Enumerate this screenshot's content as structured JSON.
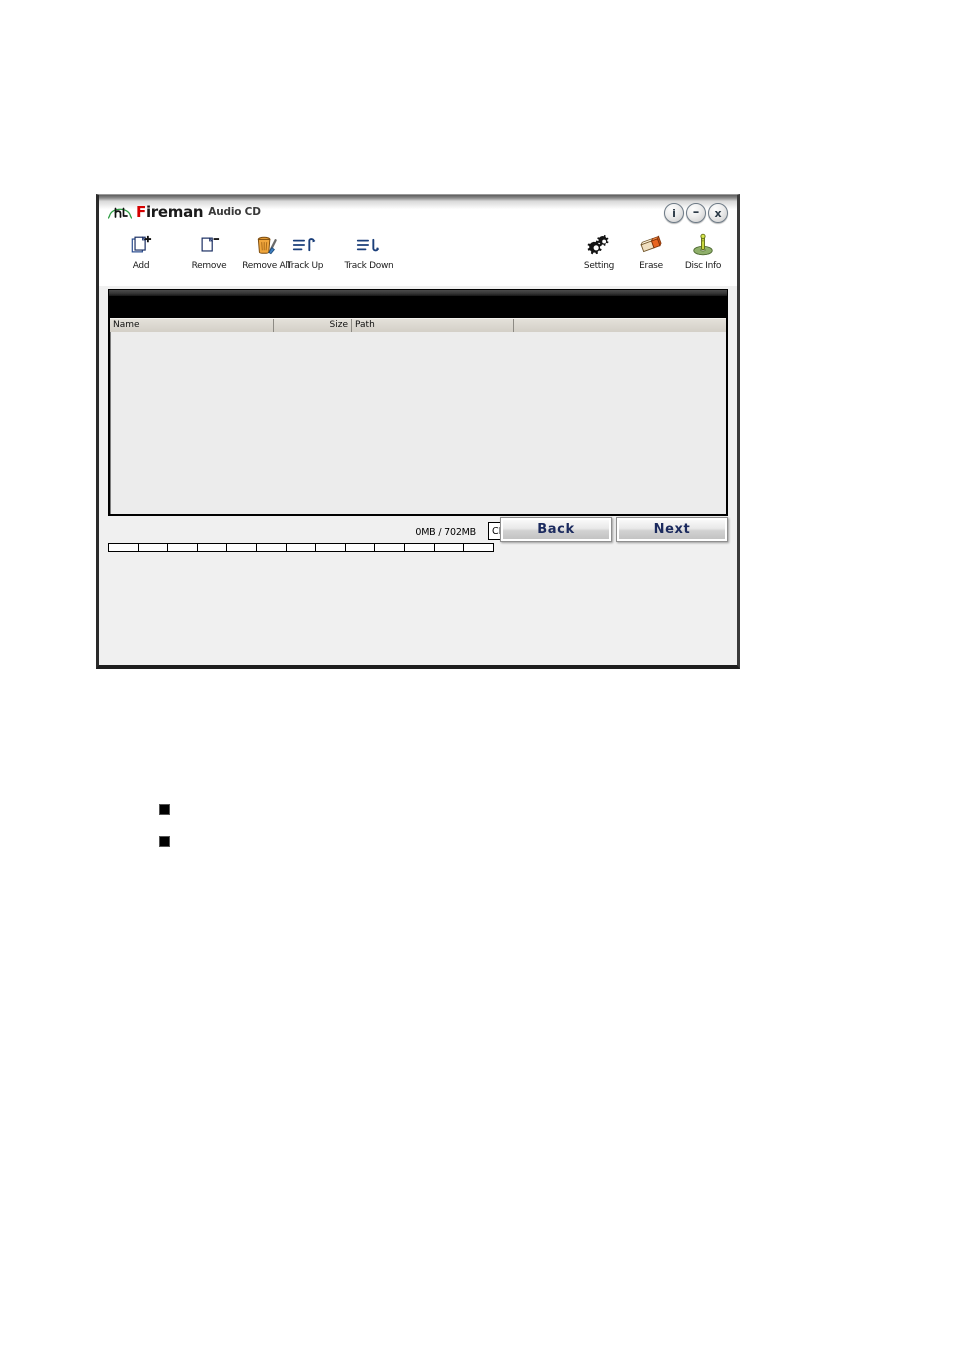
{
  "window": {
    "title_logo_mark": "fireman-logo-icon",
    "brand_first_letter": "F",
    "brand_rest": "ireman",
    "brand_sub": "Audio CD",
    "controls": [
      {
        "name": "info-button",
        "glyph": "i"
      },
      {
        "name": "minimize-button",
        "glyph": "–"
      },
      {
        "name": "close-button",
        "glyph": "x"
      }
    ]
  },
  "toolbar": {
    "left_tools": [
      {
        "label": "Add",
        "icon": "add-file-icon"
      },
      {
        "label": "Remove",
        "icon": "remove-file-icon"
      },
      {
        "label": "Remove All",
        "icon": "remove-all-trash-icon"
      }
    ],
    "mid_tools": [
      {
        "label": "Track Up",
        "icon": "track-up-icon"
      },
      {
        "label": "Track Down",
        "icon": "track-down-icon"
      }
    ],
    "right_tools": [
      {
        "label": "Setting",
        "icon": "gears-icon"
      },
      {
        "label": "Erase",
        "icon": "eraser-icon"
      },
      {
        "label": "Disc Info",
        "icon": "disc-info-icon"
      }
    ]
  },
  "list": {
    "columns": [
      {
        "key": "name",
        "label": "Name"
      },
      {
        "key": "size",
        "label": "Size"
      },
      {
        "key": "path",
        "label": "Path"
      }
    ],
    "rows": []
  },
  "status": {
    "capacity_text": "0MB / 702MB",
    "used_mb": 0,
    "total_mb": 702,
    "media_type_selected": "CD",
    "media_type_options": [
      "CD"
    ],
    "progress_segments": 13,
    "progress_percent": 0
  },
  "navigation": {
    "back_label": "Back",
    "next_label": "Next"
  },
  "colors": {
    "brand_red": "#d50000",
    "brand_green": "#2f9e44",
    "button_text": "#1b2a5e",
    "list_background": "#ececec",
    "header_background": "#d7d3cb"
  },
  "page_bullets": [
    {
      "name": "bullet-item-1"
    },
    {
      "name": "bullet-item-2"
    }
  ]
}
